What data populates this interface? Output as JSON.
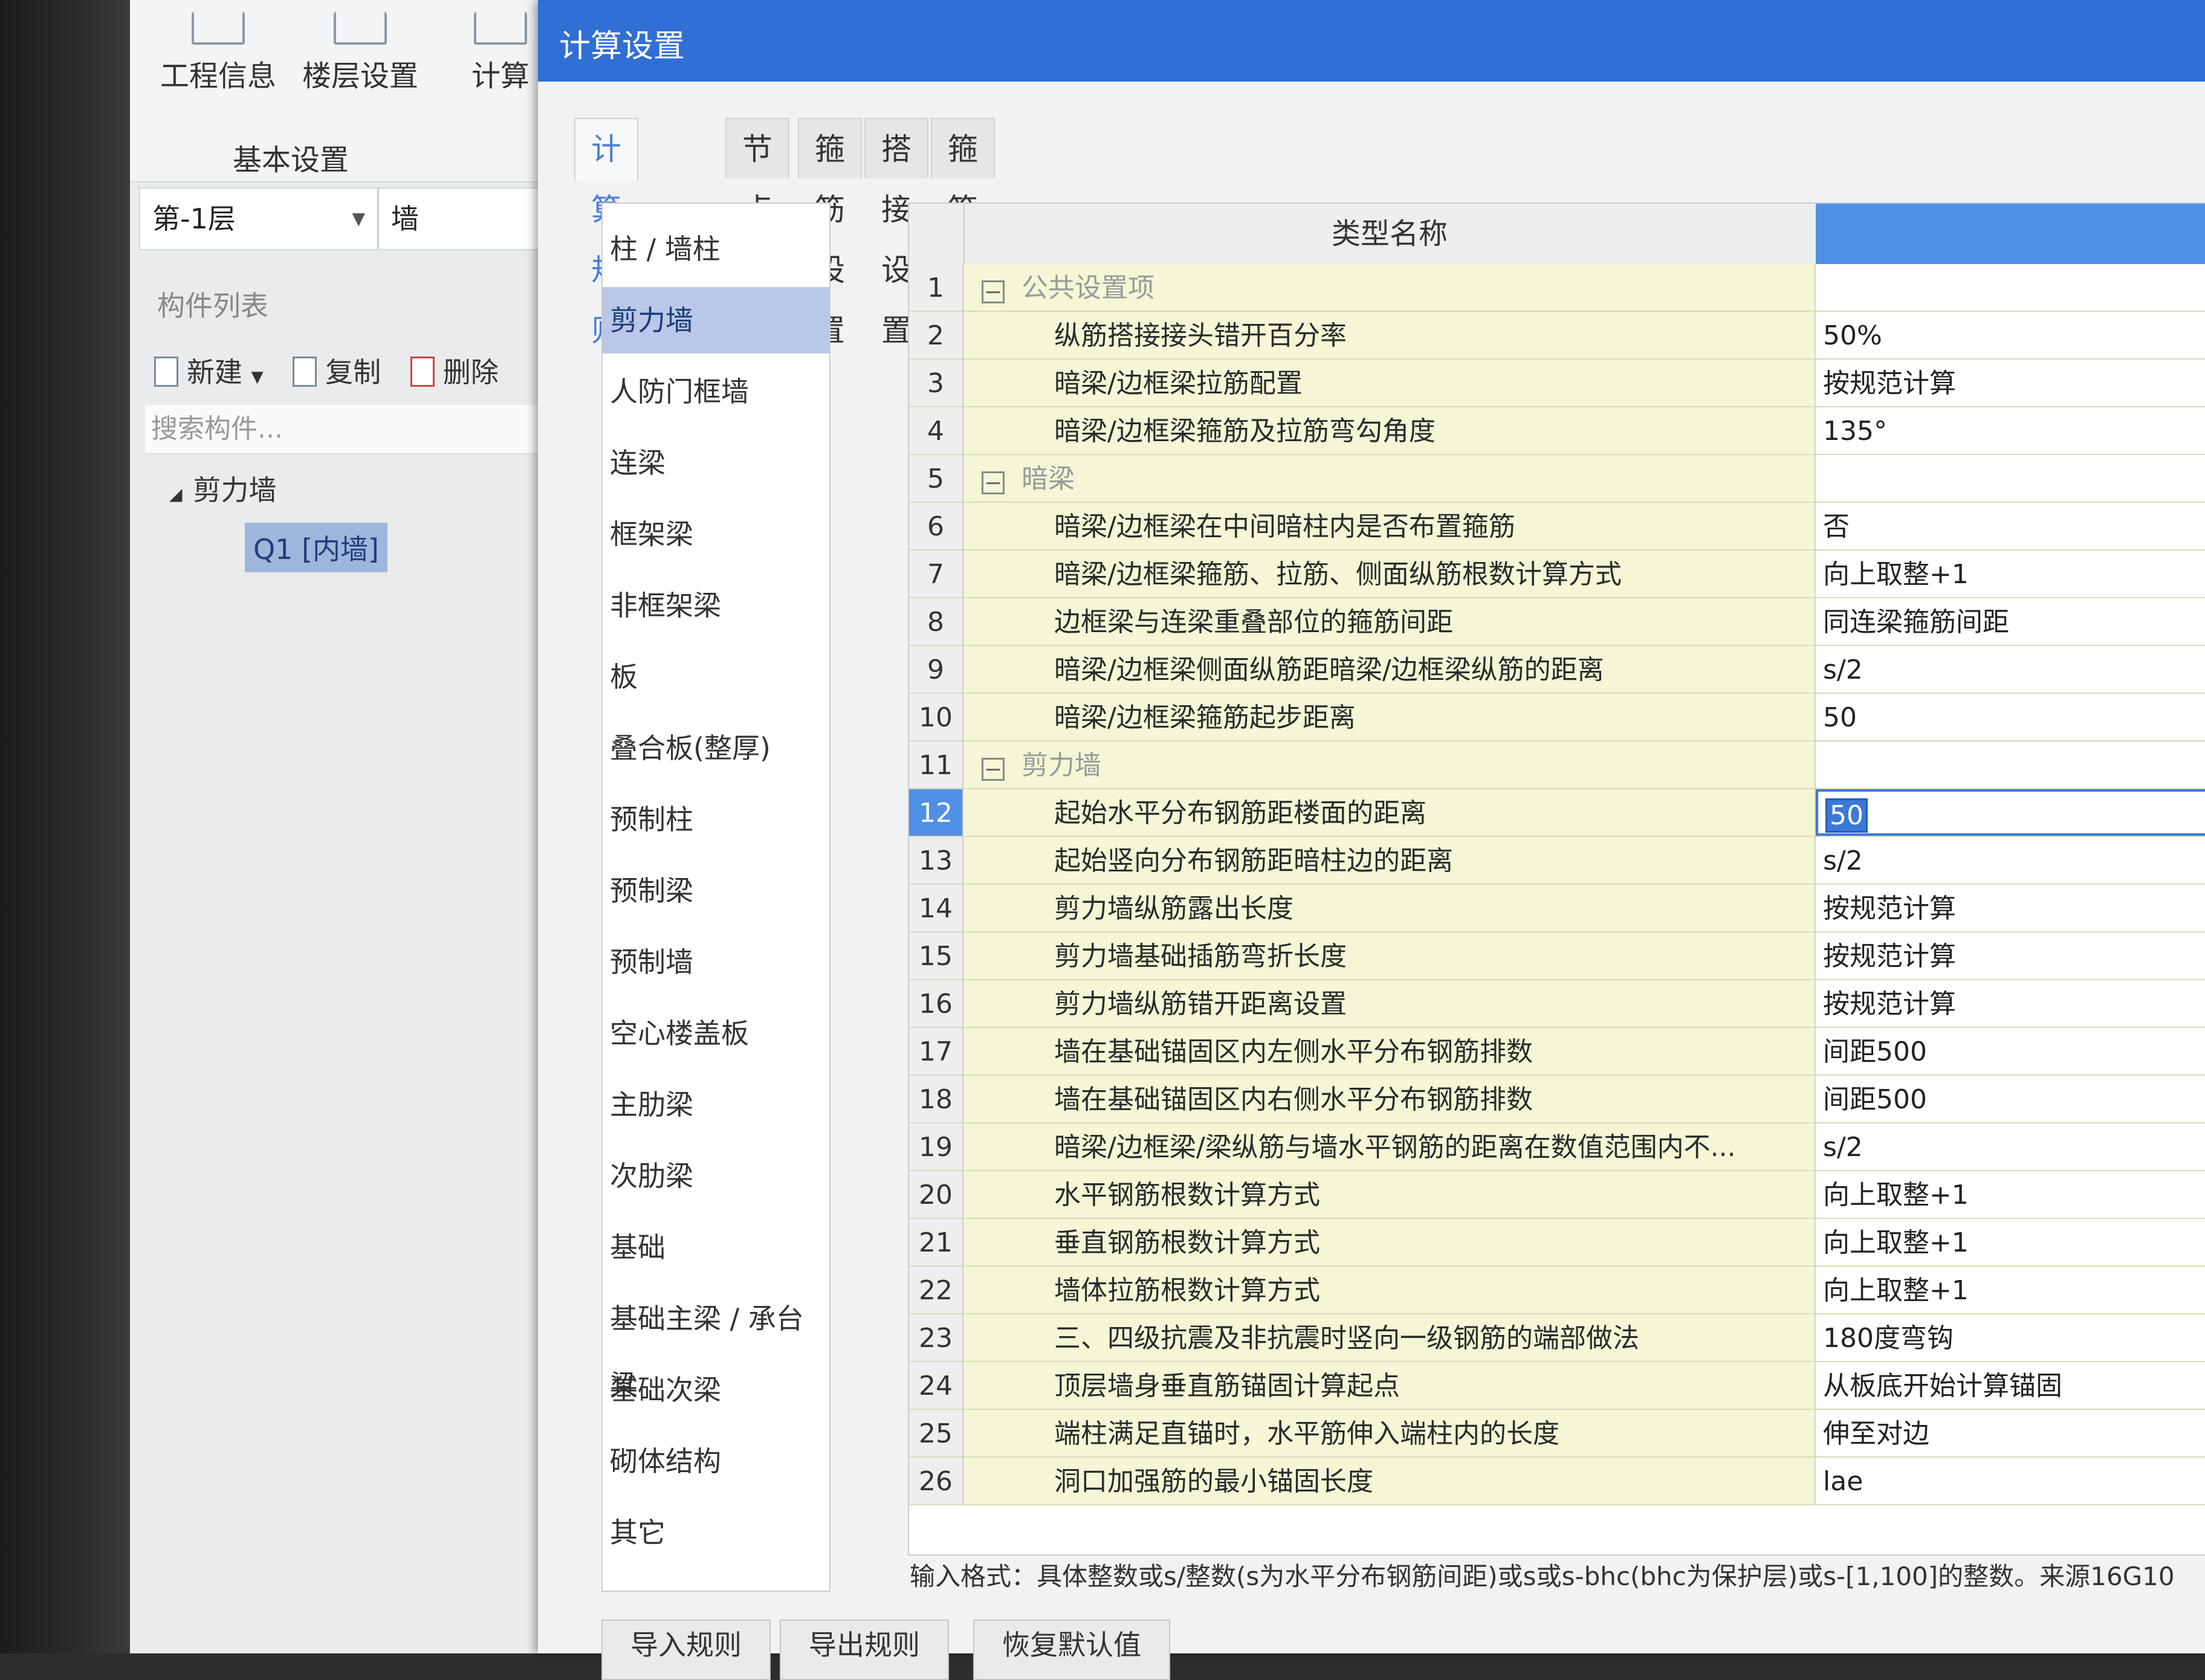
{
  "app": {
    "ribbon": {
      "buttons": [
        "工程信息",
        "楼层设置",
        "计算"
      ],
      "group_label": "基本设置"
    },
    "floor_select": "第-1层",
    "component_type": "墙",
    "component_list_title": "构件列表",
    "toolbar": {
      "new": "新建",
      "copy": "复制",
      "delete": "删除"
    },
    "search_placeholder": "搜索构件...",
    "tree": {
      "root": "剪力墙",
      "child": "Q1 [内墙]"
    }
  },
  "dialog": {
    "title": "计算设置",
    "tabs": [
      "计算规则",
      "节点设置",
      "箍筋设置",
      "搭接设置",
      "箍筋公式"
    ],
    "active_tab": "计算规则",
    "categories": [
      "柱 / 墙柱",
      "剪力墙",
      "人防门框墙",
      "连梁",
      "框架梁",
      "非框架梁",
      "板",
      "叠合板(整厚)",
      "预制柱",
      "预制梁",
      "预制墙",
      "空心楼盖板",
      "主肋梁",
      "次肋梁",
      "基础",
      "基础主梁 / 承台梁",
      "基础次梁",
      "砌体结构",
      "其它"
    ],
    "selected_category": "剪力墙",
    "grid": {
      "header_name": "类型名称",
      "rows": [
        {
          "num": "1",
          "name": "公共设置项",
          "value": "",
          "group": true
        },
        {
          "num": "2",
          "name": "纵筋搭接接头错开百分率",
          "value": "50%"
        },
        {
          "num": "3",
          "name": "暗梁/边框梁拉筋配置",
          "value": "按规范计算"
        },
        {
          "num": "4",
          "name": "暗梁/边框梁箍筋及拉筋弯勾角度",
          "value": "135°"
        },
        {
          "num": "5",
          "name": "暗梁",
          "value": "",
          "group": true
        },
        {
          "num": "6",
          "name": "暗梁/边框梁在中间暗柱内是否布置箍筋",
          "value": "否"
        },
        {
          "num": "7",
          "name": "暗梁/边框梁箍筋、拉筋、侧面纵筋根数计算方式",
          "value": "向上取整+1"
        },
        {
          "num": "8",
          "name": "边框梁与连梁重叠部位的箍筋间距",
          "value": "同连梁箍筋间距"
        },
        {
          "num": "9",
          "name": "暗梁/边框梁侧面纵筋距暗梁/边框梁纵筋的距离",
          "value": "s/2"
        },
        {
          "num": "10",
          "name": "暗梁/边框梁箍筋起步距离",
          "value": "50"
        },
        {
          "num": "11",
          "name": "剪力墙",
          "value": "",
          "group": true
        },
        {
          "num": "12",
          "name": "起始水平分布钢筋距楼面的距离",
          "value": "50",
          "editing": true
        },
        {
          "num": "13",
          "name": "起始竖向分布钢筋距暗柱边的距离",
          "value": "s/2"
        },
        {
          "num": "14",
          "name": "剪力墙纵筋露出长度",
          "value": "按规范计算"
        },
        {
          "num": "15",
          "name": "剪力墙基础插筋弯折长度",
          "value": "按规范计算"
        },
        {
          "num": "16",
          "name": "剪力墙纵筋错开距离设置",
          "value": "按规范计算"
        },
        {
          "num": "17",
          "name": "墙在基础锚固区内左侧水平分布钢筋排数",
          "value": "间距500"
        },
        {
          "num": "18",
          "name": "墙在基础锚固区内右侧水平分布钢筋排数",
          "value": "间距500"
        },
        {
          "num": "19",
          "name": "暗梁/边框梁/梁纵筋与墙水平钢筋的距离在数值范围内不...",
          "value": "s/2"
        },
        {
          "num": "20",
          "name": "水平钢筋根数计算方式",
          "value": "向上取整+1"
        },
        {
          "num": "21",
          "name": "垂直钢筋根数计算方式",
          "value": "向上取整+1"
        },
        {
          "num": "22",
          "name": "墙体拉筋根数计算方式",
          "value": "向上取整+1"
        },
        {
          "num": "23",
          "name": "三、四级抗震及非抗震时竖向一级钢筋的端部做法",
          "value": "180度弯钩"
        },
        {
          "num": "24",
          "name": "顶层墙身垂直筋锚固计算起点",
          "value": "从板底开始计算锚固"
        },
        {
          "num": "25",
          "name": "端柱满足直锚时，水平筋伸入端柱内的长度",
          "value": "伸至对边"
        },
        {
          "num": "26",
          "name": "洞口加强筋的最小锚固长度",
          "value": "lae"
        }
      ]
    },
    "hint": "输入格式：具体整数或s/整数(s为水平分布钢筋间距)或s或s-bhc(bhc为保护层)或s-[1,100]的整数。来源16G10",
    "buttons": [
      "导入规则",
      "导出规则",
      "恢复默认值"
    ]
  },
  "colors": {
    "titlebar": "#2f6fd6",
    "selection": "#4f8fe6",
    "name_column_bg": "#f5f6d6"
  }
}
